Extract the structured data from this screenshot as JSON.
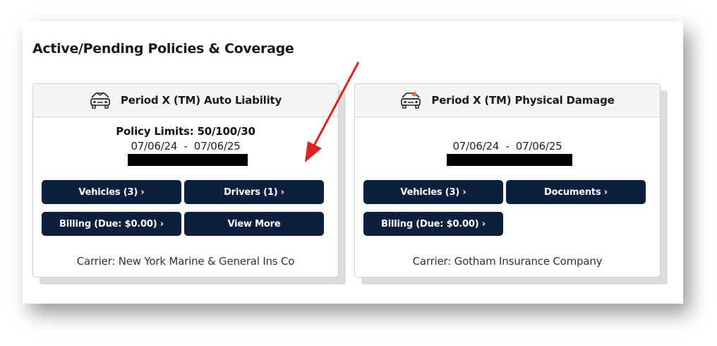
{
  "section": {
    "title": "Active/Pending Policies & Coverage"
  },
  "cards": [
    {
      "icon": "car-icon",
      "title": "Period X (TM) Auto Liability",
      "limits": "Policy Limits: 50/100/30",
      "date_start": "07/06/24",
      "date_sep": "-",
      "date_end": "07/06/25",
      "buttons": [
        "Vehicles (3) ›",
        "Drivers (1) ›",
        "Billing (Due: $0.00) ›",
        "View More"
      ],
      "carrier": "Carrier: New York Marine & General Ins Co"
    },
    {
      "icon": "car-damage-icon",
      "title": "Period X (TM) Physical Damage",
      "date_start": "07/06/24",
      "date_sep": "-",
      "date_end": "07/06/25",
      "buttons": [
        "Vehicles (3) ›",
        "Documents ›",
        "Billing (Due: $0.00) ›"
      ],
      "carrier": "Carrier: Gotham Insurance Company"
    }
  ],
  "colors": {
    "button": "#0d1f3f",
    "arrow": "#e02020",
    "damage_accent": "#f26b3a"
  }
}
